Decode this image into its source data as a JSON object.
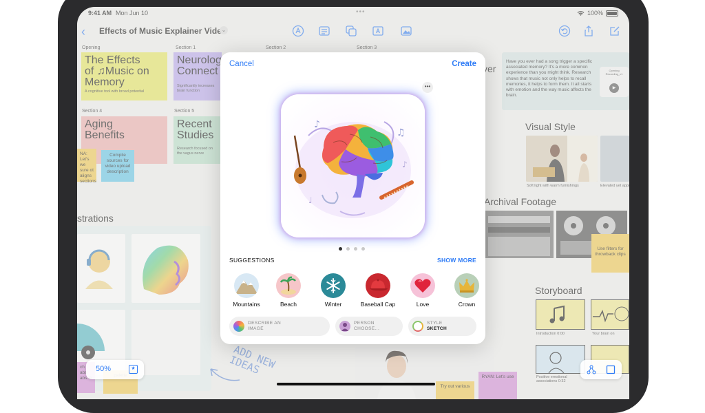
{
  "status": {
    "time": "9:41 AM",
    "date": "Mon Jun 10",
    "battery": "100%"
  },
  "toolbar": {
    "title": "Effects of Music Explainer Video",
    "icons": [
      "back-chevron-icon",
      "pen-icon",
      "list-icon",
      "shapes-icon",
      "textbox-icon",
      "media-icon",
      "undo-icon",
      "share-icon",
      "compose-icon"
    ]
  },
  "board": {
    "opening_label": "Opening",
    "section1_label": "Section 1",
    "section2_label": "Section 2",
    "section3_label": "Section 3",
    "section4_label": "Section 4",
    "section5_label": "Section 5",
    "card_opening_title_l1": "The Effects",
    "card_opening_title_l2": "of ♫Music on",
    "card_opening_title_l3": "Memory",
    "card_opening_sub": "A cognitive tool with broad potential",
    "card_s1_title": "Neurolog",
    "card_s1_title2": "Connect",
    "card_s1_sub": "Significantly increases brain function",
    "card_s4_title": "Aging",
    "card_s4_title2": "Benefits",
    "card_s5_title": "Recent",
    "card_s5_title2": "Studies",
    "card_s5_sub": "Research focused on the vagus nerve",
    "sticky_yellow": "NA: Let's we sure ot aligns sections",
    "sticky_blue": "Compile sources for video upload description",
    "over_text": "ver",
    "quote_text": "Have you ever had a song trigger a specific associated memory? It's a more common experience than you might think. Research shows that music not only helps to recall memories, it helps to form them. It all starts with emotion and the way music affects the brain.",
    "recording_label": "Opening Recording_v1",
    "visual_style": "Visual Style",
    "cap_left": "Soft light with warm furnishings",
    "cap_right": "Elevated yet approa",
    "archival": "Archival Footage",
    "sticky_filters": "Use filters for throwback clips",
    "storyboard": "Storyboard",
    "story1": "Introduction 0:00",
    "story2": "Your brain on",
    "story3": "Positive emotional associations 0:32",
    "illustrations": "strations",
    "handwriting": "ADD NEW IDEAS",
    "sticky_bottom1": "Try out various",
    "sticky_bottom2": "RYAN: Let's use",
    "sticky_palette": "palette",
    "sticky_pink_l": "ch abs abs fo"
  },
  "modal": {
    "cancel": "Cancel",
    "create": "Create",
    "more": "•••",
    "pages": 4,
    "current_page": 1,
    "suggestions_title": "SUGGESTIONS",
    "show_more": "SHOW MORE",
    "suggestions": [
      {
        "label": "Mountains",
        "icon": "mountains-icon"
      },
      {
        "label": "Beach",
        "icon": "beach-icon"
      },
      {
        "label": "Winter",
        "icon": "snowflake-icon"
      },
      {
        "label": "Baseball Cap",
        "icon": "baseball-cap-icon"
      },
      {
        "label": "Love",
        "icon": "heart-icon"
      },
      {
        "label": "Crown",
        "icon": "crown-icon"
      }
    ],
    "options": [
      {
        "line1": "DESCRIBE AN",
        "line2": "IMAGE",
        "icon": "prompt-icon"
      },
      {
        "line1": "PERSON",
        "line2": "CHOOSE...",
        "icon": "person-icon"
      },
      {
        "line1": "STYLE",
        "line2": "SKETCH",
        "icon": "style-icon"
      }
    ]
  },
  "bottom": {
    "zoom": "50%"
  },
  "colors": {
    "accent": "#2f7cf6",
    "yellow_card": "#e7e75c",
    "purple_card": "#b9a6ee",
    "pink_card": "#eeadab",
    "green_card": "#b8e0c9"
  }
}
